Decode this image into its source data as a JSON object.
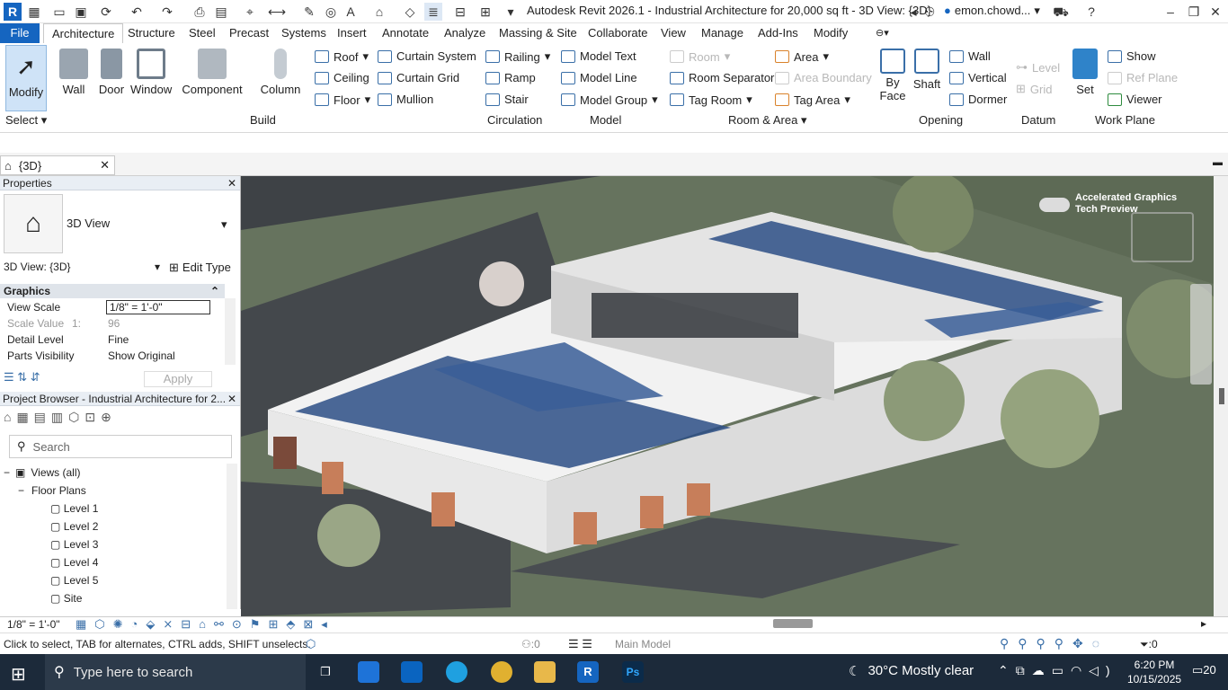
{
  "window": {
    "title": "Autodesk Revit 2026.1 - Industrial Architecture for 20,000 sq ft - 3D View: {3D}",
    "user": "emon.chowd..."
  },
  "tabs": [
    "File",
    "Architecture",
    "Structure",
    "Steel",
    "Precast",
    "Systems",
    "Insert",
    "Annotate",
    "Analyze",
    "Massing & Site",
    "Collaborate",
    "View",
    "Manage",
    "Add-Ins",
    "Modify"
  ],
  "active_tab": "Architecture",
  "ribbon": {
    "select": {
      "modify": "Modify",
      "group": "Select"
    },
    "build": {
      "wall": "Wall",
      "door": "Door",
      "window": "Window",
      "component": "Component",
      "column": "Column",
      "roof": "Roof",
      "ceiling": "Ceiling",
      "floor": "Floor",
      "curtain_system": "Curtain System",
      "curtain_grid": "Curtain Grid",
      "mullion": "Mullion",
      "group": "Build"
    },
    "circulation": {
      "railing": "Railing",
      "ramp": "Ramp",
      "stair": "Stair",
      "group": "Circulation"
    },
    "model": {
      "text": "Model Text",
      "line": "Model Line",
      "model_group": "Model Group",
      "group": "Model"
    },
    "room_area": {
      "room": "Room",
      "room_separator": "Room Separator",
      "tag_room": "Tag Room",
      "area": "Area",
      "area_boundary": "Area Boundary",
      "tag_area": "Tag Area",
      "group": "Room & Area"
    },
    "opening": {
      "by_face": "By Face",
      "by_face_sub": "Face",
      "by_face_top": "By",
      "shaft": "Shaft",
      "wall": "Wall",
      "vertical": "Vertical",
      "dormer": "Dormer",
      "group": "Opening"
    },
    "datum": {
      "level": "Level",
      "grid": "Grid",
      "group": "Datum"
    },
    "work_plane": {
      "set": "Set",
      "show": "Show",
      "ref_plane": "Ref Plane",
      "viewer": "Viewer",
      "group": "Work Plane"
    }
  },
  "view_tab": {
    "label": "{3D}"
  },
  "properties": {
    "title": "Properties",
    "type_name": "3D View",
    "selector": "3D View: {3D}",
    "edit_type": "Edit Type",
    "section": "Graphics",
    "rows": [
      {
        "key": "View Scale",
        "value": "1/8\" = 1'-0\""
      },
      {
        "key": "Scale Value",
        "value": "96",
        "prefix": "1:"
      },
      {
        "key": "Detail Level",
        "value": "Fine"
      },
      {
        "key": "Parts Visibility",
        "value": "Show Original"
      }
    ],
    "apply": "Apply"
  },
  "browser": {
    "title": "Project Browser - Industrial Architecture for 2...",
    "search_placeholder": "Search",
    "root": "Views (all)",
    "group": "Floor Plans",
    "items": [
      "Level 1",
      "Level 2",
      "Level 3",
      "Level 4",
      "Level 5",
      "Site"
    ]
  },
  "canvas": {
    "toggle_label": "Accelerated Graphics",
    "toggle_sub": "Tech Preview"
  },
  "status": {
    "scale": "1/8\" = 1'-0\"",
    "hint": "Click to select, TAB for alternates, CTRL adds, SHIFT unselects.",
    "count": ":0",
    "model": "Main Model",
    "filter_count": ":0"
  },
  "taskbar": {
    "search": "Type here to search",
    "weather": "30°C  Mostly clear",
    "time": "6:20 PM",
    "date": "10/15/2025",
    "notif": "20"
  }
}
